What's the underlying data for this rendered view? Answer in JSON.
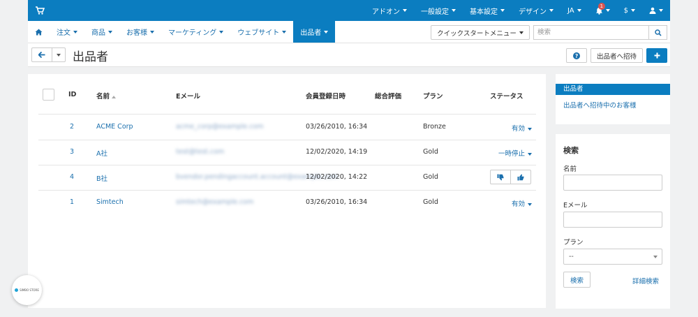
{
  "topbar": {
    "items": [
      {
        "label": "アドオン"
      },
      {
        "label": "一般設定"
      },
      {
        "label": "基本設定"
      },
      {
        "label": "デザイン"
      },
      {
        "label": "JA"
      },
      {
        "label": "$"
      }
    ],
    "notification_count": "1"
  },
  "nav": {
    "items": [
      {
        "label": "注文"
      },
      {
        "label": "商品"
      },
      {
        "label": "お客様"
      },
      {
        "label": "マーケティング"
      },
      {
        "label": "ウェブサイト"
      },
      {
        "label": "出品者"
      }
    ],
    "quick_menu": "クイックスタートメニュー",
    "search_placeholder": "検索"
  },
  "header": {
    "title": "出品者",
    "invite_button": "出品者へ招待"
  },
  "table": {
    "columns": {
      "id": "ID",
      "name": "名前",
      "email": "Eメール",
      "registered": "会員登録日時",
      "rating": "総合評価",
      "plan": "プラン",
      "status": "ステータス"
    },
    "rows": [
      {
        "id": "2",
        "name": "ACME Corp",
        "email": "acme_corp@example.com",
        "registered": "03/26/2010, 16:34",
        "plan": "Bronze",
        "status": "有効"
      },
      {
        "id": "3",
        "name": "A社",
        "email": "test@test.com",
        "registered": "12/02/2020, 14:19",
        "plan": "Gold",
        "status": "一時停止"
      },
      {
        "id": "4",
        "name": "B社",
        "email": "bvendor.pendingaccount.account@example.com",
        "registered": "12/02/2020, 14:22",
        "plan": "Gold",
        "status": ""
      },
      {
        "id": "1",
        "name": "Simtech",
        "email": "simtech@example.com",
        "registered": "03/26/2010, 16:34",
        "plan": "Gold",
        "status": "有効"
      }
    ]
  },
  "sidebar": {
    "active_item": "出品者",
    "link_item": "出品者へ招待中のお客様"
  },
  "search_panel": {
    "title": "検索",
    "name_label": "名前",
    "email_label": "Eメール",
    "plan_label": "プラン",
    "plan_selected": "--",
    "search_button": "検索",
    "advanced_link": "詳細検索"
  },
  "logo_text": "SIMBO STORE",
  "colors": {
    "brand": "#0b7dc0",
    "link": "#1a6fad",
    "background": "#f0f1f2"
  }
}
